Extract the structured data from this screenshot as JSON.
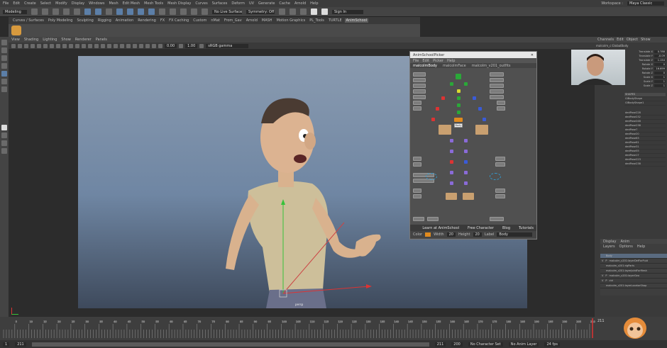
{
  "menubar": {
    "items": [
      "File",
      "Edit",
      "Create",
      "Select",
      "Modify",
      "Display",
      "Windows",
      "Mesh",
      "Edit Mesh",
      "Mesh Tools",
      "Mesh Display",
      "Curves",
      "Surfaces",
      "Deform",
      "UV",
      "Generate",
      "Cache",
      "Arnold",
      "Help"
    ],
    "workspace_label": "Workspace :",
    "workspace_value": "Maya Classic"
  },
  "statusline": {
    "mode": "Modeling",
    "live_surface": "No Live Surface",
    "symmetry": "Symmetry: Off",
    "sign_in": "Sign In"
  },
  "shelf_tabs": {
    "items": [
      "Curves / Surfaces",
      "Poly Modeling",
      "Sculpting",
      "Rigging",
      "Animation",
      "Rendering",
      "FX",
      "FX Caching",
      "Custom",
      "nMat",
      "From_Gav",
      "Arnold",
      "MASH",
      "Motion Graphics",
      "PL_Tools",
      "TURTLE",
      "AnimSchool"
    ],
    "active_index": 16
  },
  "panel": {
    "menu": [
      "View",
      "Shading",
      "Lighting",
      "Show",
      "Renderer",
      "Panels"
    ],
    "gamma_value": "0.00",
    "exposure_value": "1.00",
    "color_space": "sRGB gamma"
  },
  "picker": {
    "title": "AnimSchoolPicker",
    "menu": [
      "File",
      "Edit",
      "Picker",
      "Help"
    ],
    "tabs": [
      "malcolmBody",
      "malcolmFace",
      "malcolm_v201_outfits"
    ],
    "active_tab": 0,
    "footer": [
      "Learn at AnimSchool",
      "Free Character",
      "Blog",
      "Tutorials"
    ],
    "color_label": "Color",
    "color_value": "#e08a1e",
    "width_label": "Width",
    "width_value": "20",
    "height_label": "Height",
    "height_value": "20",
    "label_label": "Label",
    "label_value": "Body",
    "center_label": "Body"
  },
  "viewport": {
    "camera_label": "persp"
  },
  "channel_box": {
    "menu": [
      "Channels",
      "Edit",
      "Object",
      "Show"
    ],
    "object": "malcolm_c:GlobalBody",
    "attrs": [
      {
        "name": "Translate X",
        "value": "0.788"
      },
      {
        "name": "Translate Y",
        "value": "-0.09"
      },
      {
        "name": "Translate Z",
        "value": "1.154"
      },
      {
        "name": "Rotate X",
        "value": "0"
      },
      {
        "name": "Rotate Y",
        "value": "16.699"
      },
      {
        "name": "Rotate Z",
        "value": "0"
      },
      {
        "name": "Scale X",
        "value": "1"
      },
      {
        "name": "Scale Y",
        "value": "1"
      },
      {
        "name": "Scale Z",
        "value": "1"
      }
    ],
    "shapes_header": "SHAPES",
    "shapes": [
      "GlBodyShape",
      "GlBodyShape1"
    ],
    "inputs": [
      "dedPose228",
      "dedPose232",
      "dedPose248",
      "dedPose238",
      "dedPose7",
      "dedPose20",
      "dedPose83",
      "dedPose61",
      "dedPose31",
      "dedPose55",
      "dedPose17",
      "dedPose223",
      "dedPose238"
    ]
  },
  "layer_editor": {
    "tabs": [
      "Display",
      "Anim"
    ],
    "menu": [
      "Layers",
      "Options",
      "Help"
    ],
    "layers": [
      {
        "v": "",
        "p": "",
        "name": "Body",
        "selected": true
      },
      {
        "v": "V",
        "p": "P",
        "name": "malcolm_v201:layerDefForPuld"
      },
      {
        "v": "",
        "p": "",
        "name": "malcolm_v201:rigParts"
      },
      {
        "v": "",
        "p": "",
        "name": "malcolm_v201:layerJointForMesh"
      },
      {
        "v": "V",
        "p": "P",
        "name": "malcolm_v201:layerGeo"
      },
      {
        "v": "V",
        "p": "P",
        "name": "ctrl"
      },
      {
        "v": "",
        "p": "",
        "name": "malcolm_v201:layerLocatorShap"
      }
    ]
  },
  "timeline": {
    "start_frame": "1",
    "end_frame": "211",
    "current_frame": "211",
    "ticks": [
      "5",
      "10",
      "15",
      "20",
      "25",
      "30",
      "35",
      "40",
      "45",
      "50",
      "55",
      "60",
      "65",
      "70",
      "75",
      "80",
      "85",
      "90",
      "95",
      "100",
      "105",
      "110",
      "115",
      "120",
      "125",
      "130",
      "135",
      "140",
      "145",
      "150",
      "155",
      "160",
      "165",
      "170",
      "175",
      "180",
      "185",
      "190",
      "195",
      "200",
      "205",
      "210"
    ]
  },
  "rangebar": {
    "min": "211",
    "playback_start": "211",
    "playback_end": "211",
    "fps": "200",
    "char_set": "No Character Set",
    "anim_layer": "No Anim Layer",
    "fps_label": "24 fps"
  }
}
